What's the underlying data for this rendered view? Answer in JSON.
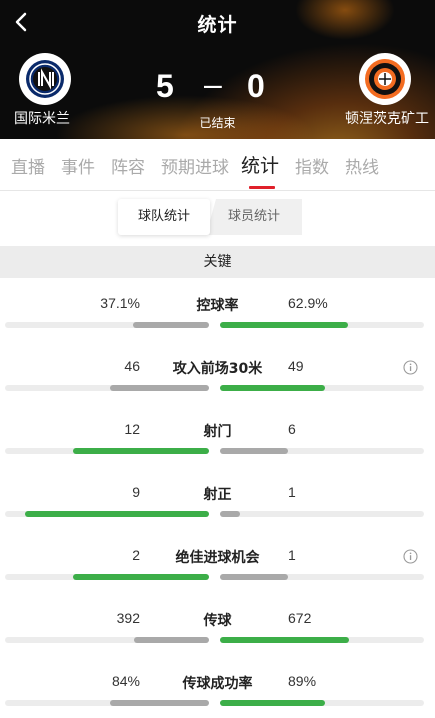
{
  "header": {
    "title": "统计",
    "back_icon": "back-chevron-icon",
    "status": "已结束"
  },
  "match": {
    "home_team": "国际米兰",
    "away_team": "顿涅茨克矿工",
    "home_score": "5",
    "away_score": "0",
    "separator": "–"
  },
  "tabs": [
    {
      "label": "直播"
    },
    {
      "label": "事件"
    },
    {
      "label": "阵容"
    },
    {
      "label": "预期进球"
    },
    {
      "label": "统计"
    },
    {
      "label": "指数"
    },
    {
      "label": "热线"
    }
  ],
  "active_tab": "统计",
  "segment": {
    "team": "球队统计",
    "player": "球员统计",
    "selected": "球队统计"
  },
  "section_title": "关键",
  "colors": {
    "winner_bar": "#3cae48",
    "loser_bar": "#a9a9a9",
    "accent": "#e0202a"
  },
  "stats": [
    {
      "label": "控球率",
      "home": "37.1%",
      "away": "62.9%",
      "home_frac": 0.371,
      "away_frac": 0.629,
      "info": false
    },
    {
      "label": "攻入前场30米",
      "home": "46",
      "away": "49",
      "home_frac": 0.484,
      "away_frac": 0.516,
      "info": true
    },
    {
      "label": "射门",
      "home": "12",
      "away": "6",
      "home_frac": 0.667,
      "away_frac": 0.333,
      "info": false
    },
    {
      "label": "射正",
      "home": "9",
      "away": "1",
      "home_frac": 0.9,
      "away_frac": 0.1,
      "info": false
    },
    {
      "label": "绝佳进球机会",
      "home": "2",
      "away": "1",
      "home_frac": 0.667,
      "away_frac": 0.333,
      "info": true
    },
    {
      "label": "传球",
      "home": "392",
      "away": "672",
      "home_frac": 0.368,
      "away_frac": 0.632,
      "info": false
    },
    {
      "label": "传球成功率",
      "home": "84%",
      "away": "89%",
      "home_frac": 0.486,
      "away_frac": 0.514,
      "info": false
    }
  ]
}
